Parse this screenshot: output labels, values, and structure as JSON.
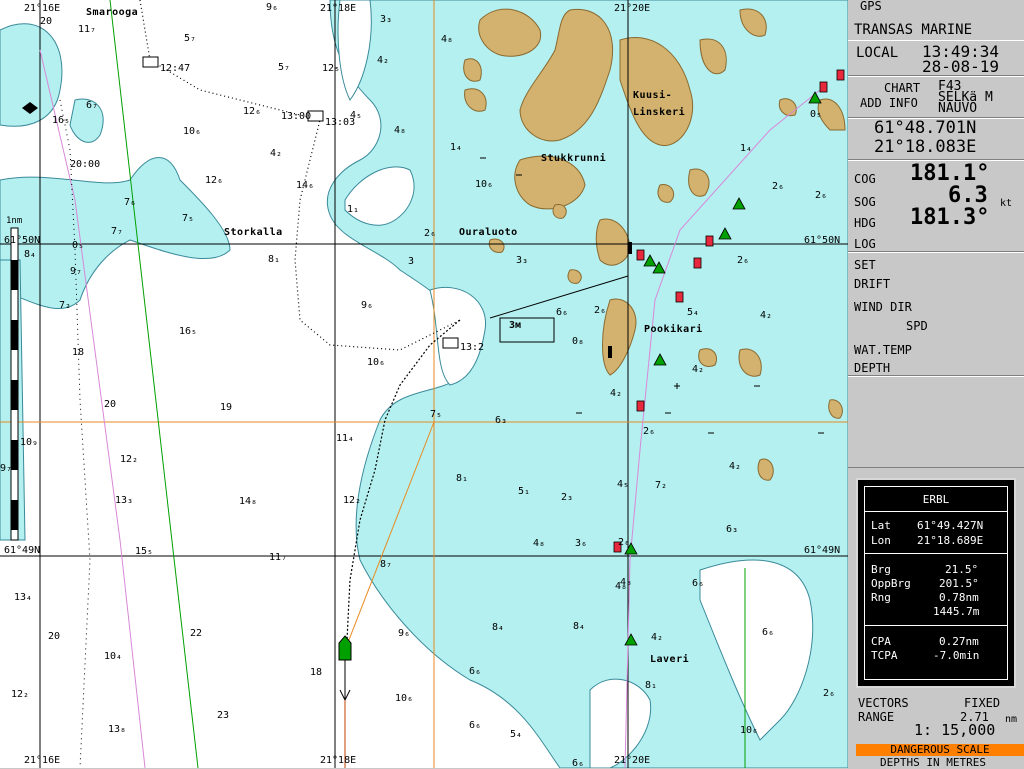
{
  "chart": {
    "lon_labels": {
      "top": [
        "21°16E",
        "21°18E",
        "21°20E"
      ],
      "bottom": [
        "21°16E",
        "21°18E",
        "21°20E"
      ]
    },
    "lat_labels": {
      "left": [
        "61°50N",
        "61°49N"
      ],
      "right": [
        "61°50N",
        "61°49N"
      ]
    },
    "scale_bar_label": "1nm",
    "place_names": {
      "smarooga": "Smarooga",
      "kuusi": "Kuusi-",
      "linskeri": "Linskeri",
      "stukkrunni": "Stukkrunni",
      "storkalla": "Storkalla",
      "ouraluoto": "Ouraluoto",
      "pookikari": "Pookikari",
      "laveri": "Laveri"
    },
    "track_times": {
      "t1": "12:47",
      "t2": "13:00",
      "t3": "13:03",
      "t4": "20:00",
      "t5": "13:2"
    },
    "sounding_box": "3м",
    "depths": [
      {
        "id": "d1",
        "v": "20"
      },
      {
        "id": "d2",
        "v": "11₇"
      },
      {
        "id": "d3",
        "v": "9₆"
      },
      {
        "id": "d4",
        "v": "3₃"
      },
      {
        "id": "d5",
        "v": "4₈"
      },
      {
        "id": "d6",
        "v": "5₇"
      },
      {
        "id": "d7",
        "v": "5₇"
      },
      {
        "id": "d8",
        "v": "12₅"
      },
      {
        "id": "d9",
        "v": "4₂"
      },
      {
        "id": "d10",
        "v": "4₅"
      },
      {
        "id": "d11",
        "v": "4₈"
      },
      {
        "id": "d12",
        "v": "6₇"
      },
      {
        "id": "d13",
        "v": "16₅"
      },
      {
        "id": "d14",
        "v": "10₆"
      },
      {
        "id": "d15",
        "v": "12₆"
      },
      {
        "id": "d16",
        "v": "4₂"
      },
      {
        "id": "d17",
        "v": "1₄"
      },
      {
        "id": "d18",
        "v": "10₆"
      },
      {
        "id": "d19",
        "v": "12₆"
      },
      {
        "id": "d20",
        "v": "14₆"
      },
      {
        "id": "d21",
        "v": "1₁"
      },
      {
        "id": "d22",
        "v": "7₆"
      },
      {
        "id": "d23",
        "v": "7₅"
      },
      {
        "id": "d24",
        "v": "7₇"
      },
      {
        "id": "d25",
        "v": "2₆"
      },
      {
        "id": "d26",
        "v": "8₄"
      },
      {
        "id": "d27",
        "v": "8₁"
      },
      {
        "id": "d28",
        "v": "3"
      },
      {
        "id": "d29",
        "v": "3₃"
      },
      {
        "id": "d30",
        "v": "9₇"
      },
      {
        "id": "d31",
        "v": "7₂"
      },
      {
        "id": "d32",
        "v": "16₅"
      },
      {
        "id": "d33",
        "v": "9₆"
      },
      {
        "id": "d34",
        "v": "6₆"
      },
      {
        "id": "d35",
        "v": "2₆"
      },
      {
        "id": "d36",
        "v": "0₈"
      },
      {
        "id": "d37",
        "v": "18"
      },
      {
        "id": "d38",
        "v": "10₆"
      },
      {
        "id": "d39",
        "v": "20"
      },
      {
        "id": "d40",
        "v": "19"
      },
      {
        "id": "d41",
        "v": "7₅"
      },
      {
        "id": "d42",
        "v": "6₃"
      },
      {
        "id": "d43",
        "v": "4₂"
      },
      {
        "id": "d44",
        "v": "2₆"
      },
      {
        "id": "d45",
        "v": "4₂"
      },
      {
        "id": "d46",
        "v": "10₉"
      },
      {
        "id": "d47",
        "v": "11₄"
      },
      {
        "id": "d48",
        "v": "12₂"
      },
      {
        "id": "d49",
        "v": "8₁"
      },
      {
        "id": "d50",
        "v": "5₁"
      },
      {
        "id": "d51",
        "v": "2₃"
      },
      {
        "id": "d52",
        "v": "4₅"
      },
      {
        "id": "d53",
        "v": "7₂"
      },
      {
        "id": "d54",
        "v": "4₂"
      },
      {
        "id": "d55",
        "v": "13₃"
      },
      {
        "id": "d56",
        "v": "14₈"
      },
      {
        "id": "d57",
        "v": "12₂"
      },
      {
        "id": "d58",
        "v": "4₈"
      },
      {
        "id": "d59",
        "v": "3₆"
      },
      {
        "id": "d60",
        "v": "6₃"
      },
      {
        "id": "d61",
        "v": "15₅"
      },
      {
        "id": "d62",
        "v": "11₇"
      },
      {
        "id": "d63",
        "v": "8₇"
      },
      {
        "id": "d64",
        "v": "4₈"
      },
      {
        "id": "d65",
        "v": "6₆"
      },
      {
        "id": "d66",
        "v": "13₄"
      },
      {
        "id": "d67",
        "v": "20"
      },
      {
        "id": "d68",
        "v": "22"
      },
      {
        "id": "d69",
        "v": "9₆"
      },
      {
        "id": "d70",
        "v": "8₄"
      },
      {
        "id": "d71",
        "v": "8₄"
      },
      {
        "id": "d72",
        "v": "4₂"
      },
      {
        "id": "d73",
        "v": "6₆"
      },
      {
        "id": "d74",
        "v": "10₄"
      },
      {
        "id": "d75",
        "v": "18"
      },
      {
        "id": "d76",
        "v": "6₆"
      },
      {
        "id": "d77",
        "v": "8₁"
      },
      {
        "id": "d78",
        "v": "12₂"
      },
      {
        "id": "d79",
        "v": "23"
      },
      {
        "id": "d80",
        "v": "10₆"
      },
      {
        "id": "d81",
        "v": "13₈"
      },
      {
        "id": "d82",
        "v": "6₆"
      },
      {
        "id": "d83",
        "v": "5₄"
      },
      {
        "id": "d84",
        "v": "6₆"
      },
      {
        "id": "d85",
        "v": "10₆"
      },
      {
        "id": "d86",
        "v": "2₆"
      },
      {
        "id": "d87",
        "v": "1₄"
      },
      {
        "id": "d88",
        "v": "2₆"
      },
      {
        "id": "d89",
        "v": "2₆"
      },
      {
        "id": "d90",
        "v": "2₆"
      },
      {
        "id": "d91",
        "v": "5₄"
      },
      {
        "id": "d92",
        "v": "4₂"
      },
      {
        "id": "d93",
        "v": "0₅"
      },
      {
        "id": "d94",
        "v": "4₈"
      },
      {
        "id": "d95",
        "v": "0₅"
      },
      {
        "id": "d96",
        "v": "9₇"
      },
      {
        "id": "d97",
        "v": "2₆"
      }
    ]
  },
  "panel": {
    "gps": "GPS",
    "brand": "TRANSAS MARINE",
    "local_label": "LOCAL",
    "local_time": "13:49:34",
    "local_date": "28-08-19",
    "chart_label": "CHART",
    "chart_name": "F43",
    "add_info_label": "ADD INFO",
    "add_info_1": "SELKä M",
    "add_info_2": "NAUVO",
    "lat": "61°48.701N",
    "lon": "21°18.083E",
    "cog_label": "COG",
    "cog": "181.1°",
    "sog_label": "SOG",
    "sog": "6.3",
    "sog_unit": "kt",
    "hdg_label": "HDG",
    "hdg": "181.3°",
    "log_label": "LOG",
    "set_label": "SET",
    "drift_label": "DRIFT",
    "wind_dir_label": "WIND DIR",
    "spd_label": "SPD",
    "wat_temp_label": "WAT.TEMP",
    "depth_label": "DEPTH",
    "vectors_label": "VECTORS",
    "vectors_mode": "FIXED",
    "range_label": "RANGE",
    "range_value": "2.71",
    "range_unit": "nm",
    "scale": "1: 15,000",
    "dangerous_scale": "DANGEROUS SCALE",
    "depths_in": "DEPTHS IN METRES"
  },
  "erbl": {
    "title": "ERBL",
    "lat_label": "Lat",
    "lat": "61°49.427N",
    "lon_label": "Lon",
    "lon": "21°18.689E",
    "brg_label": "Brg",
    "brg": "21.5°",
    "oppbrg_label": "OppBrg",
    "oppbrg": "201.5°",
    "rng_label": "Rng",
    "rng_nm": "0.78nm",
    "rng_m": "1445.7m",
    "cpa_label": "CPA",
    "cpa": "0.27nm",
    "tcpa_label": "TCPA",
    "tcpa": "-7.0min"
  },
  "colors": {
    "shallow": "#b4f0f0",
    "land": "#d2b26e",
    "deep": "#ffffff",
    "grid": "#000000",
    "lat_line": "#e88a20",
    "track": "#000000",
    "green_line": "#00a000",
    "danger": "#ff7f00"
  }
}
